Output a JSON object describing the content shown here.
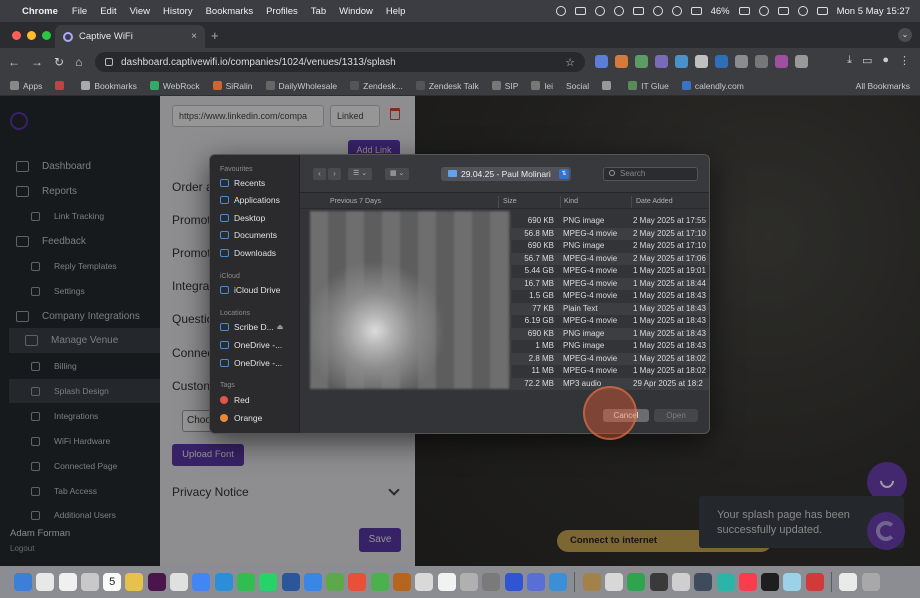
{
  "menubar": {
    "app_name": "Chrome",
    "menus": [
      "File",
      "Edit",
      "View",
      "History",
      "Bookmarks",
      "Profiles",
      "Tab",
      "Window",
      "Help"
    ],
    "battery": "46%",
    "datetime": "Mon 5 May  15:27"
  },
  "browser": {
    "tab_title": "Captive WiFi",
    "url": "dashboard.captivewifi.io/companies/1024/venues/1313/splash",
    "bookmarks": [
      "Apps",
      "Bookmarks",
      "WebRock",
      "SiRalin",
      "DailyWholesale",
      "Zendesk...",
      "Zendesk Talk",
      "SIP",
      "lei",
      "Social",
      "IT Glue",
      "calendly.com"
    ],
    "all_bookmarks": "All Bookmarks"
  },
  "sidebar": {
    "items": [
      {
        "label": "Dashboard",
        "sub": false,
        "active": false
      },
      {
        "label": "Reports",
        "sub": false,
        "active": false
      },
      {
        "label": "Link Tracking",
        "sub": true,
        "active": false
      },
      {
        "label": "Feedback",
        "sub": false,
        "active": false
      },
      {
        "label": "Reply Templates",
        "sub": true,
        "active": false
      },
      {
        "label": "Settings",
        "sub": true,
        "active": false
      },
      {
        "label": "Company Integrations",
        "sub": false,
        "active": false
      },
      {
        "label": "Manage Venue",
        "sub": false,
        "active": true
      },
      {
        "label": "Billing",
        "sub": true,
        "active": false
      },
      {
        "label": "Splash Design",
        "sub": true,
        "active": true
      },
      {
        "label": "Integrations",
        "sub": true,
        "active": false
      },
      {
        "label": "WiFi Hardware",
        "sub": true,
        "active": false
      },
      {
        "label": "Connected Page",
        "sub": true,
        "active": false
      },
      {
        "label": "Tab Access",
        "sub": true,
        "active": false
      },
      {
        "label": "Additional Users",
        "sub": true,
        "active": false
      }
    ],
    "user_name": "Adam Forman",
    "logout": "Logout"
  },
  "editor": {
    "link_url": "https://www.linkedin.com/compa",
    "link_type": "Linked",
    "add_link": "Add Link",
    "sections": [
      "Order a",
      "Promot",
      "Promot",
      "Integra",
      "Questio",
      "Connec",
      "Custon"
    ],
    "choose_file": "Choo",
    "upload_font": "Upload Font",
    "privacy_notice": "Privacy Notice",
    "save": "Save"
  },
  "preview": {
    "connect": "Connect to internet",
    "toast": "Your splash page has been successfully updated."
  },
  "dialog": {
    "favourites_label": "Favourites",
    "favourites": [
      "Recents",
      "Applications",
      "Desktop",
      "Documents",
      "Downloads"
    ],
    "icloud_label": "iCloud",
    "icloud": [
      "iCloud Drive"
    ],
    "locations_label": "Locations",
    "locations": [
      "Scribe D...",
      "OneDrive -...",
      "OneDrive -..."
    ],
    "tags_label": "Tags",
    "tags": [
      {
        "name": "Red",
        "color": "#e0584a"
      },
      {
        "name": "Orange",
        "color": "#e98a3b"
      }
    ],
    "folder": "29.04.25 - Paul Molinari",
    "search_placeholder": "Search",
    "group_header": "Previous 7 Days",
    "col_size": "Size",
    "col_kind": "Kind",
    "col_date": "Date Added",
    "files": [
      {
        "size": "690 KB",
        "kind": "PNG image",
        "date": "2 May 2025 at 17:55"
      },
      {
        "size": "56.8 MB",
        "kind": "MPEG-4 movie",
        "date": "2 May 2025 at 17:10"
      },
      {
        "size": "690 KB",
        "kind": "PNG image",
        "date": "2 May 2025 at 17:10"
      },
      {
        "size": "56.7 MB",
        "kind": "MPEG-4 movie",
        "date": "2 May 2025 at 17:06"
      },
      {
        "size": "5.44 GB",
        "kind": "MPEG-4 movie",
        "date": "1 May 2025 at 19:01"
      },
      {
        "size": "16.7 MB",
        "kind": "MPEG-4 movie",
        "date": "1 May 2025 at 18:44"
      },
      {
        "size": "1.5 GB",
        "kind": "MPEG-4 movie",
        "date": "1 May 2025 at 18:43"
      },
      {
        "size": "77 KB",
        "kind": "Plain Text",
        "date": "1 May 2025 at 18:43"
      },
      {
        "size": "6.19 GB",
        "kind": "MPEG-4 movie",
        "date": "1 May 2025 at 18:43"
      },
      {
        "size": "690 KB",
        "kind": "PNG image",
        "date": "1 May 2025 at 18:43"
      },
      {
        "size": "1 MB",
        "kind": "PNG image",
        "date": "1 May 2025 at 18:43"
      },
      {
        "size": "2.8 MB",
        "kind": "MPEG-4 movie",
        "date": "1 May 2025 at 18:02"
      },
      {
        "size": "11 MB",
        "kind": "MPEG-4 movie",
        "date": "1 May 2025 at 18:02"
      },
      {
        "size": "72.2 MB",
        "kind": "MP3 audio",
        "date": "29 Apr 2025 at 18:2"
      }
    ],
    "cancel": "Cancel",
    "open": "Open"
  },
  "dock": {
    "calendar_day": "5"
  }
}
